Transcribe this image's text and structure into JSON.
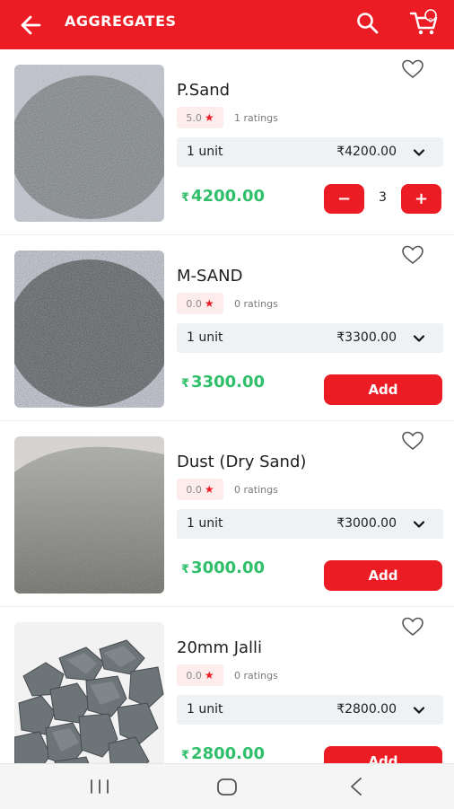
{
  "appbar": {
    "title": "AGGREGATES",
    "back_icon": "arrow-left-icon",
    "search_icon": "search-icon",
    "cart_icon": "cart-icon",
    "cart_count": "0",
    "color": "#ec1c24"
  },
  "products": [
    {
      "name": "P.Sand",
      "rating": "5.0",
      "ratings_text": "1 ratings",
      "unit": "1 unit",
      "unit_price": "₹4200.00",
      "currency": "₹",
      "price": "4200.00",
      "quantity": "3",
      "qty_minus": "−",
      "qty_plus": "+",
      "in_cart": true
    },
    {
      "name": "M-SAND",
      "rating": "0.0",
      "ratings_text": "0 ratings",
      "unit": "1 unit",
      "unit_price": "₹3300.00",
      "currency": "₹",
      "price": "3300.00",
      "add_label": "Add",
      "in_cart": false
    },
    {
      "name": "Dust (Dry Sand)",
      "rating": "0.0",
      "ratings_text": "0 ratings",
      "unit": "1 unit",
      "unit_price": "₹3000.00",
      "currency": "₹",
      "price": "3000.00",
      "add_label": "Add",
      "in_cart": false
    },
    {
      "name": "20mm Jalli",
      "rating": "0.0",
      "ratings_text": "0 ratings",
      "unit": "1 unit",
      "unit_price": "₹2800.00",
      "currency": "₹",
      "price": "2800.00",
      "add_label": "Add",
      "in_cart": false
    }
  ],
  "colors": {
    "accent": "#ec1c24",
    "price_green": "#2fbf6a",
    "rating_bg": "#fdecec",
    "select_bg": "#eef2f5"
  },
  "navbar": {
    "recent_icon": "recent-apps-icon",
    "home_icon": "home-icon",
    "back_icon": "back-chevron-icon"
  }
}
